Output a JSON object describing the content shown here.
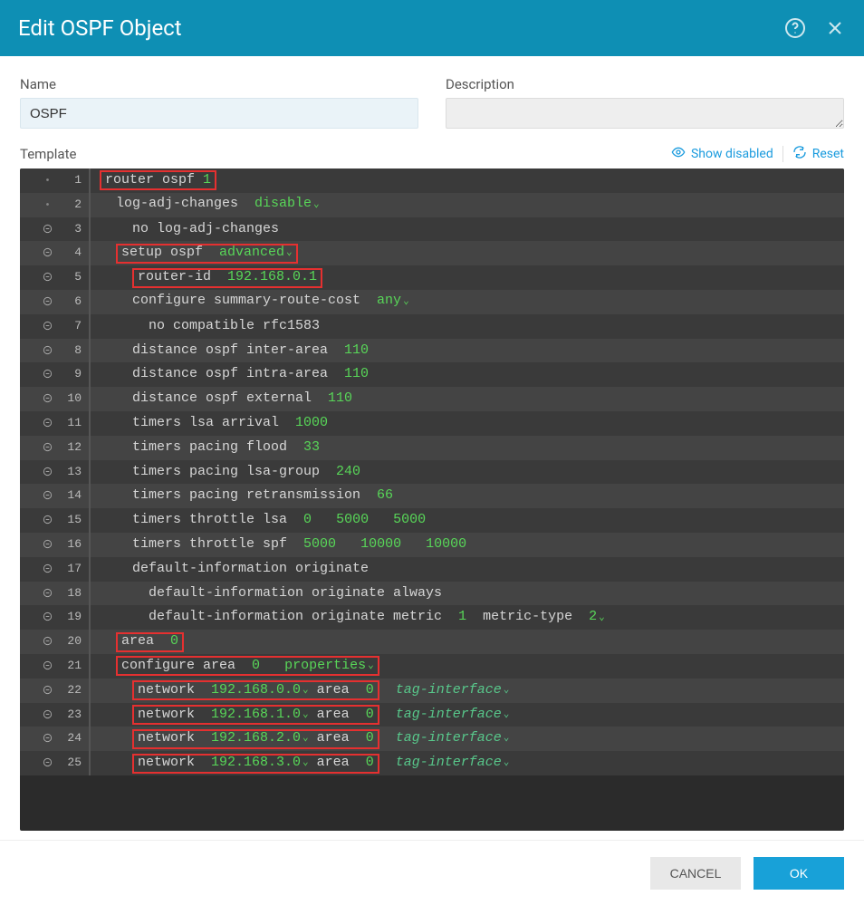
{
  "header": {
    "title": "Edit OSPF Object"
  },
  "fields": {
    "name_label": "Name",
    "name_value": "OSPF",
    "desc_label": "Description",
    "desc_value": ""
  },
  "toolbar": {
    "template_label": "Template",
    "show_disabled": "Show disabled",
    "reset": "Reset"
  },
  "footer": {
    "cancel": "CANCEL",
    "ok": "OK"
  },
  "icons": {
    "help": "help-circle-icon",
    "close": "close-icon",
    "eye": "eye-icon",
    "reset": "refresh-icon",
    "collapse": "circle-minus-icon"
  },
  "code": {
    "lines": [
      {
        "n": 1,
        "indent": 0,
        "red": true,
        "segments": [
          {
            "t": "router ospf ",
            "c": "plain"
          },
          {
            "t": "1",
            "c": "green"
          }
        ],
        "collapse": "dot"
      },
      {
        "n": 2,
        "indent": 1,
        "red": false,
        "segments": [
          {
            "t": "log-adj-changes  ",
            "c": "plain"
          },
          {
            "t": "disable",
            "c": "green",
            "dd": true
          }
        ],
        "collapse": "dot"
      },
      {
        "n": 3,
        "indent": 2,
        "red": false,
        "segments": [
          {
            "t": "no log-adj-changes",
            "c": "plain"
          }
        ],
        "collapse": "minus"
      },
      {
        "n": 4,
        "indent": 1,
        "red": true,
        "segments": [
          {
            "t": "setup ospf  ",
            "c": "plain"
          },
          {
            "t": "advanced",
            "c": "green",
            "dd": true
          }
        ],
        "collapse": "minus"
      },
      {
        "n": 5,
        "indent": 2,
        "red": true,
        "segments": [
          {
            "t": "router-id  ",
            "c": "plain"
          },
          {
            "t": "192.168.0.1",
            "c": "green"
          }
        ],
        "collapse": "minus"
      },
      {
        "n": 6,
        "indent": 2,
        "red": false,
        "segments": [
          {
            "t": "configure summary-route-cost  ",
            "c": "plain"
          },
          {
            "t": "any",
            "c": "green",
            "dd": true
          }
        ],
        "collapse": "minus"
      },
      {
        "n": 7,
        "indent": 3,
        "red": false,
        "segments": [
          {
            "t": "no compatible rfc1583",
            "c": "plain"
          }
        ],
        "collapse": "minus"
      },
      {
        "n": 8,
        "indent": 2,
        "red": false,
        "segments": [
          {
            "t": "distance ospf inter-area  ",
            "c": "plain"
          },
          {
            "t": "110",
            "c": "green"
          }
        ],
        "collapse": "minus"
      },
      {
        "n": 9,
        "indent": 2,
        "red": false,
        "segments": [
          {
            "t": "distance ospf intra-area  ",
            "c": "plain"
          },
          {
            "t": "110",
            "c": "green"
          }
        ],
        "collapse": "minus"
      },
      {
        "n": 10,
        "indent": 2,
        "red": false,
        "segments": [
          {
            "t": "distance ospf external  ",
            "c": "plain"
          },
          {
            "t": "110",
            "c": "green"
          }
        ],
        "collapse": "minus"
      },
      {
        "n": 11,
        "indent": 2,
        "red": false,
        "segments": [
          {
            "t": "timers lsa arrival  ",
            "c": "plain"
          },
          {
            "t": "1000",
            "c": "green"
          }
        ],
        "collapse": "minus"
      },
      {
        "n": 12,
        "indent": 2,
        "red": false,
        "segments": [
          {
            "t": "timers pacing flood  ",
            "c": "plain"
          },
          {
            "t": "33",
            "c": "green"
          }
        ],
        "collapse": "minus"
      },
      {
        "n": 13,
        "indent": 2,
        "red": false,
        "segments": [
          {
            "t": "timers pacing lsa-group  ",
            "c": "plain"
          },
          {
            "t": "240",
            "c": "green"
          }
        ],
        "collapse": "minus"
      },
      {
        "n": 14,
        "indent": 2,
        "red": false,
        "segments": [
          {
            "t": "timers pacing retransmission  ",
            "c": "plain"
          },
          {
            "t": "66",
            "c": "green"
          }
        ],
        "collapse": "minus"
      },
      {
        "n": 15,
        "indent": 2,
        "red": false,
        "segments": [
          {
            "t": "timers throttle lsa  ",
            "c": "plain"
          },
          {
            "t": "0",
            "c": "green"
          },
          {
            "t": "   ",
            "c": "plain"
          },
          {
            "t": "5000",
            "c": "green"
          },
          {
            "t": "   ",
            "c": "plain"
          },
          {
            "t": "5000",
            "c": "green"
          }
        ],
        "collapse": "minus"
      },
      {
        "n": 16,
        "indent": 2,
        "red": false,
        "segments": [
          {
            "t": "timers throttle spf  ",
            "c": "plain"
          },
          {
            "t": "5000",
            "c": "green"
          },
          {
            "t": "   ",
            "c": "plain"
          },
          {
            "t": "10000",
            "c": "green"
          },
          {
            "t": "   ",
            "c": "plain"
          },
          {
            "t": "10000",
            "c": "green"
          }
        ],
        "collapse": "minus"
      },
      {
        "n": 17,
        "indent": 2,
        "red": false,
        "segments": [
          {
            "t": "default-information originate",
            "c": "plain"
          }
        ],
        "collapse": "minus"
      },
      {
        "n": 18,
        "indent": 3,
        "red": false,
        "segments": [
          {
            "t": "default-information originate always",
            "c": "plain"
          }
        ],
        "collapse": "minus"
      },
      {
        "n": 19,
        "indent": 3,
        "red": false,
        "segments": [
          {
            "t": "default-information originate metric  ",
            "c": "plain"
          },
          {
            "t": "1",
            "c": "green"
          },
          {
            "t": "  metric-type  ",
            "c": "plain"
          },
          {
            "t": "2",
            "c": "green",
            "dd": true
          }
        ],
        "collapse": "minus"
      },
      {
        "n": 20,
        "indent": 1,
        "red": true,
        "segments": [
          {
            "t": "area  ",
            "c": "plain"
          },
          {
            "t": "0",
            "c": "green"
          }
        ],
        "collapse": "minus"
      },
      {
        "n": 21,
        "indent": 1,
        "red": true,
        "segments": [
          {
            "t": "configure area  ",
            "c": "plain"
          },
          {
            "t": "0",
            "c": "green"
          },
          {
            "t": "   ",
            "c": "plain"
          },
          {
            "t": "properties",
            "c": "green",
            "dd": true
          }
        ],
        "collapse": "minus"
      },
      {
        "n": 22,
        "indent": 2,
        "red": true,
        "segments": [
          {
            "t": "network  ",
            "c": "plain"
          },
          {
            "t": "192.168.0.0",
            "c": "green",
            "dd": true
          },
          {
            "t": " area  ",
            "c": "plain"
          },
          {
            "t": "0",
            "c": "green"
          }
        ],
        "tail": "tag-interface",
        "collapse": "minus"
      },
      {
        "n": 23,
        "indent": 2,
        "red": true,
        "segments": [
          {
            "t": "network  ",
            "c": "plain"
          },
          {
            "t": "192.168.1.0",
            "c": "green",
            "dd": true
          },
          {
            "t": " area  ",
            "c": "plain"
          },
          {
            "t": "0",
            "c": "green"
          }
        ],
        "tail": "tag-interface",
        "collapse": "minus"
      },
      {
        "n": 24,
        "indent": 2,
        "red": true,
        "segments": [
          {
            "t": "network  ",
            "c": "plain"
          },
          {
            "t": "192.168.2.0",
            "c": "green",
            "dd": true
          },
          {
            "t": " area  ",
            "c": "plain"
          },
          {
            "t": "0",
            "c": "green"
          }
        ],
        "tail": "tag-interface",
        "collapse": "minus"
      },
      {
        "n": 25,
        "indent": 2,
        "red": true,
        "segments": [
          {
            "t": "network  ",
            "c": "plain"
          },
          {
            "t": "192.168.3.0",
            "c": "green",
            "dd": true
          },
          {
            "t": " area  ",
            "c": "plain"
          },
          {
            "t": "0",
            "c": "green"
          }
        ],
        "tail": "tag-interface",
        "collapse": "minus"
      }
    ]
  }
}
